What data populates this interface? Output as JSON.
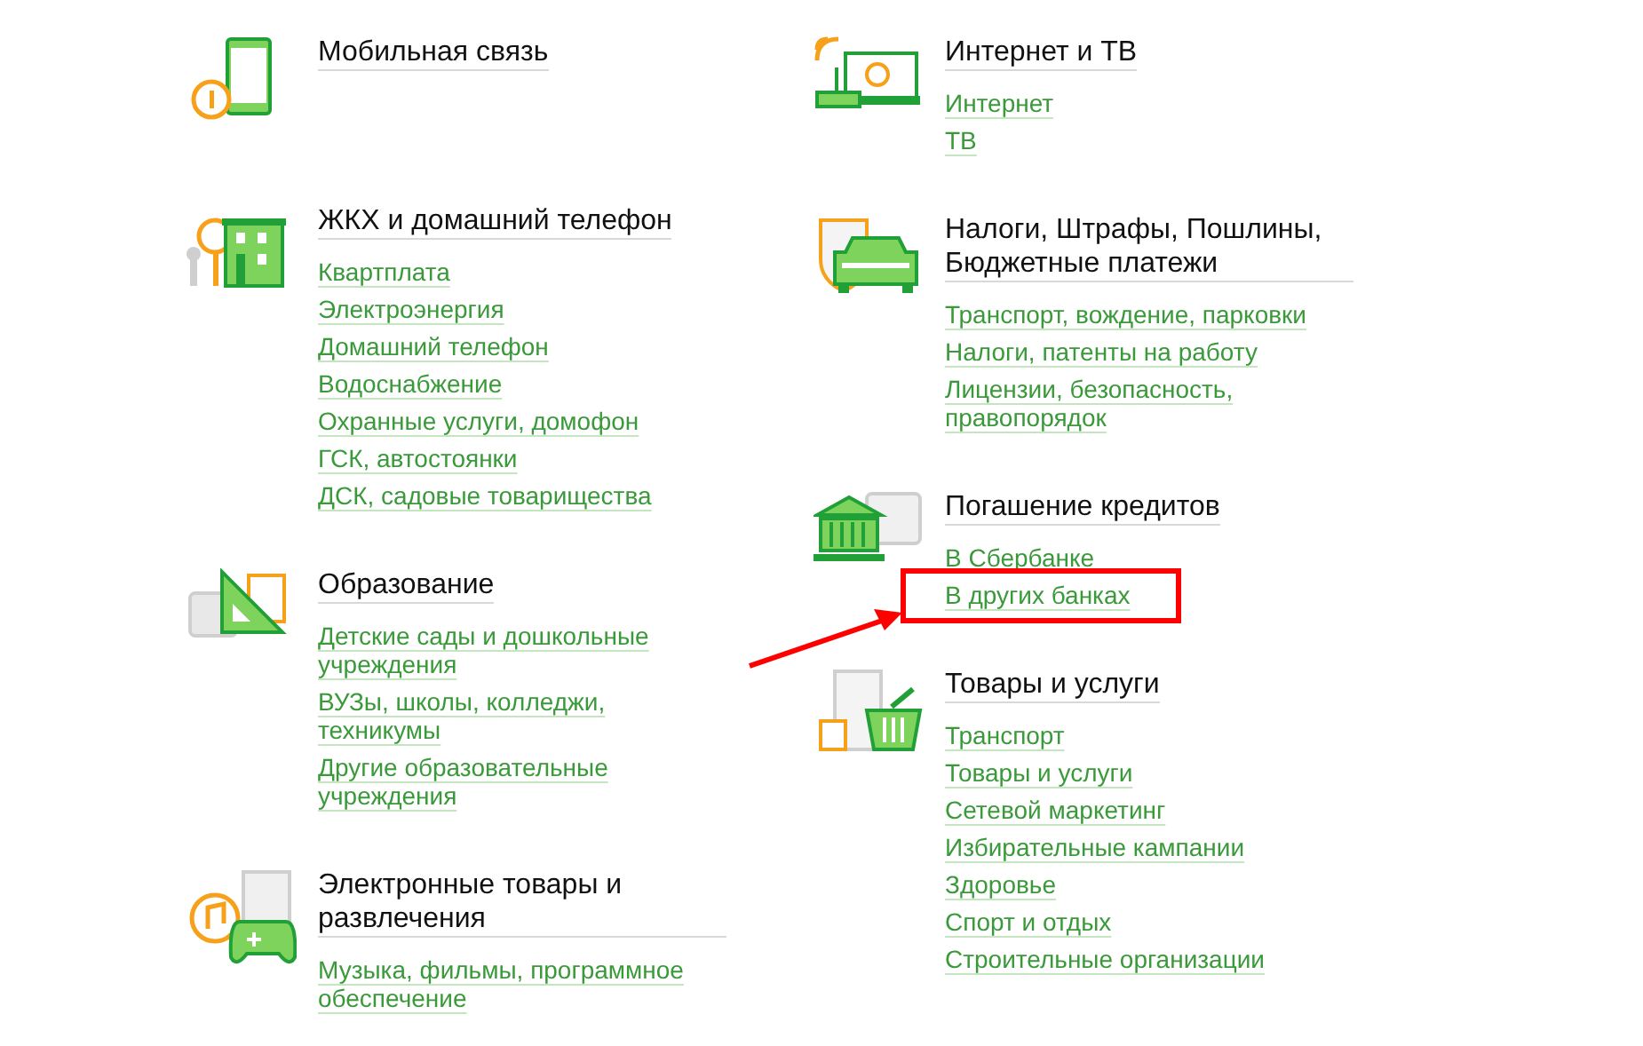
{
  "columns": [
    {
      "sections": [
        {
          "title": "Мобильная связь"
        },
        {
          "title": "ЖКХ и домашний телефон",
          "links": [
            {
              "label": "Квартплата",
              "highlighted": false
            },
            {
              "label": "Электроэнергия",
              "highlighted": false
            },
            {
              "label": "Домашний телефон",
              "highlighted": false
            },
            {
              "label": "Водоснабжение",
              "highlighted": false
            },
            {
              "label": "Охранные услуги, домофон",
              "highlighted": false
            },
            {
              "label": "ГСК, автостоянки",
              "highlighted": false
            },
            {
              "label": "ДСК, садовые товарищества",
              "highlighted": false
            }
          ]
        },
        {
          "title": "Образование",
          "links": [
            {
              "label": "Детские сады и дошкольные учреждения",
              "highlighted": false
            },
            {
              "label": "ВУЗы, школы, колледжи, техникумы",
              "highlighted": false
            },
            {
              "label": "Другие образовательные учреждения",
              "highlighted": false
            }
          ]
        },
        {
          "title": "Электронные товары и развлечения",
          "links": [
            {
              "label": "Музыка, фильмы, программное обеспечение",
              "highlighted": false
            }
          ]
        }
      ]
    },
    {
      "sections": [
        {
          "title": "Интернет и ТВ",
          "links": [
            {
              "label": "Интернет",
              "highlighted": false
            },
            {
              "label": "ТВ",
              "highlighted": false
            }
          ]
        },
        {
          "title": "Налоги, Штрафы, Пошлины, Бюджетные платежи",
          "links": [
            {
              "label": "Транспорт, вождение, парковки",
              "highlighted": false
            },
            {
              "label": "Налоги, патенты на работу",
              "highlighted": false
            },
            {
              "label": "Лицензии, безопасность, правопорядок",
              "highlighted": false
            }
          ]
        },
        {
          "title": "Погашение кредитов",
          "links": [
            {
              "label": "В Сбербанке",
              "highlighted": false
            },
            {
              "label": "В других банках",
              "highlighted": true
            }
          ]
        },
        {
          "title": "Товары и услуги",
          "links": [
            {
              "label": "Транспорт",
              "highlighted": false
            },
            {
              "label": "Товары и услуги",
              "highlighted": false
            },
            {
              "label": "Сетевой маркетинг",
              "highlighted": false
            },
            {
              "label": "Избирательные кампании",
              "highlighted": false
            },
            {
              "label": "Здоровье",
              "highlighted": false
            },
            {
              "label": "Спорт и отдых",
              "highlighted": false
            },
            {
              "label": "Строительные организации",
              "highlighted": false
            }
          ]
        }
      ]
    }
  ]
}
